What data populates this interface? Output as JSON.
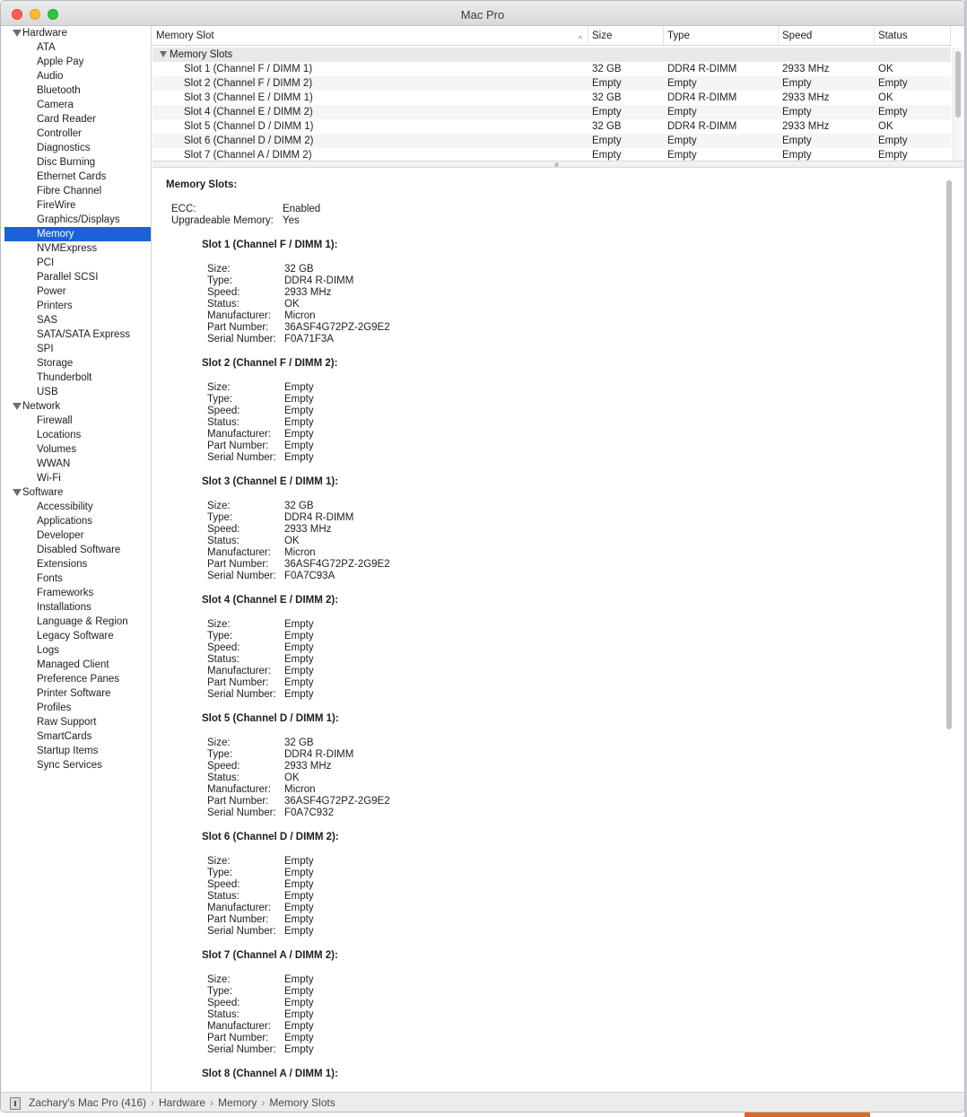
{
  "window": {
    "title": "Mac Pro"
  },
  "sidebar": {
    "groups": [
      {
        "label": "Hardware",
        "items": [
          "ATA",
          "Apple Pay",
          "Audio",
          "Bluetooth",
          "Camera",
          "Card Reader",
          "Controller",
          "Diagnostics",
          "Disc Burning",
          "Ethernet Cards",
          "Fibre Channel",
          "FireWire",
          "Graphics/Displays",
          "Memory",
          "NVMExpress",
          "PCI",
          "Parallel SCSI",
          "Power",
          "Printers",
          "SAS",
          "SATA/SATA Express",
          "SPI",
          "Storage",
          "Thunderbolt",
          "USB"
        ]
      },
      {
        "label": "Network",
        "items": [
          "Firewall",
          "Locations",
          "Volumes",
          "WWAN",
          "Wi-Fi"
        ]
      },
      {
        "label": "Software",
        "items": [
          "Accessibility",
          "Applications",
          "Developer",
          "Disabled Software",
          "Extensions",
          "Fonts",
          "Frameworks",
          "Installations",
          "Language & Region",
          "Legacy Software",
          "Logs",
          "Managed Client",
          "Preference Panes",
          "Printer Software",
          "Profiles",
          "Raw Support",
          "SmartCards",
          "Startup Items",
          "Sync Services"
        ]
      }
    ],
    "selected": "Memory"
  },
  "table": {
    "columns": [
      "Memory Slot",
      "Size",
      "Type",
      "Speed",
      "Status"
    ],
    "group_label": "Memory Slots",
    "rows": [
      [
        "Slot 1 (Channel F / DIMM 1)",
        "32 GB",
        "DDR4 R-DIMM",
        "2933 MHz",
        "OK"
      ],
      [
        "Slot 2 (Channel F / DIMM 2)",
        "Empty",
        "Empty",
        "Empty",
        "Empty"
      ],
      [
        "Slot 3 (Channel E / DIMM 1)",
        "32 GB",
        "DDR4 R-DIMM",
        "2933 MHz",
        "OK"
      ],
      [
        "Slot 4 (Channel E / DIMM 2)",
        "Empty",
        "Empty",
        "Empty",
        "Empty"
      ],
      [
        "Slot 5 (Channel D / DIMM 1)",
        "32 GB",
        "DDR4 R-DIMM",
        "2933 MHz",
        "OK"
      ],
      [
        "Slot 6 (Channel D / DIMM 2)",
        "Empty",
        "Empty",
        "Empty",
        "Empty"
      ],
      [
        "Slot 7 (Channel A / DIMM 2)",
        "Empty",
        "Empty",
        "Empty",
        "Empty"
      ]
    ]
  },
  "detail": {
    "title": "Memory Slots:",
    "summary": [
      {
        "k": "ECC:",
        "v": "Enabled"
      },
      {
        "k": "Upgradeable Memory:",
        "v": "Yes"
      }
    ],
    "field_labels": [
      "Size:",
      "Type:",
      "Speed:",
      "Status:",
      "Manufacturer:",
      "Part Number:",
      "Serial Number:"
    ],
    "slots": [
      {
        "heading": "Slot 1 (Channel F / DIMM 1):",
        "values": [
          "32 GB",
          "DDR4 R-DIMM",
          "2933 MHz",
          "OK",
          "Micron",
          "36ASF4G72PZ-2G9E2",
          "F0A71F3A"
        ]
      },
      {
        "heading": "Slot 2 (Channel F / DIMM 2):",
        "values": [
          "Empty",
          "Empty",
          "Empty",
          "Empty",
          "Empty",
          "Empty",
          "Empty"
        ]
      },
      {
        "heading": "Slot 3 (Channel E / DIMM 1):",
        "values": [
          "32 GB",
          "DDR4 R-DIMM",
          "2933 MHz",
          "OK",
          "Micron",
          "36ASF4G72PZ-2G9E2",
          "F0A7C93A"
        ]
      },
      {
        "heading": "Slot 4 (Channel E / DIMM 2):",
        "values": [
          "Empty",
          "Empty",
          "Empty",
          "Empty",
          "Empty",
          "Empty",
          "Empty"
        ]
      },
      {
        "heading": "Slot 5 (Channel D / DIMM 1):",
        "values": [
          "32 GB",
          "DDR4 R-DIMM",
          "2933 MHz",
          "OK",
          "Micron",
          "36ASF4G72PZ-2G9E2",
          "F0A7C932"
        ]
      },
      {
        "heading": "Slot 6 (Channel D / DIMM 2):",
        "values": [
          "Empty",
          "Empty",
          "Empty",
          "Empty",
          "Empty",
          "Empty",
          "Empty"
        ]
      },
      {
        "heading": "Slot 7 (Channel A / DIMM 2):",
        "values": [
          "Empty",
          "Empty",
          "Empty",
          "Empty",
          "Empty",
          "Empty",
          "Empty"
        ]
      },
      {
        "heading": "Slot 8 (Channel A / DIMM 1):",
        "values": []
      }
    ]
  },
  "pathbar": {
    "crumbs": [
      "Zachary's Mac Pro (416)",
      "Hardware",
      "Memory",
      "Memory Slots"
    ]
  },
  "colors": {
    "selection": "#1a62d8"
  },
  "icons": {
    "window_close": "close-icon",
    "window_minimize": "minimize-icon",
    "window_zoom": "zoom-icon",
    "path_root": "computer-icon"
  }
}
